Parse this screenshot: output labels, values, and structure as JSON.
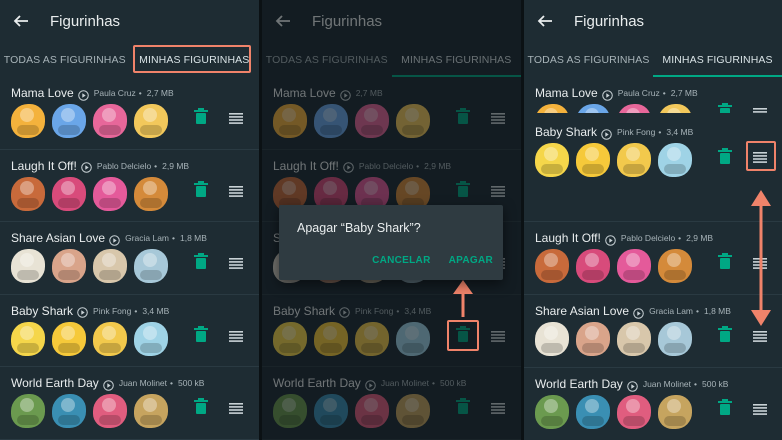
{
  "screens": [
    {
      "header": {
        "title": "Figurinhas"
      },
      "tabs": [
        {
          "label": "TODAS AS FIGURINHAS"
        },
        {
          "label": "MINHAS FIGURINHAS",
          "active": true
        }
      ],
      "packs": [
        {
          "name": "Mama Love",
          "author": "Paula Cruz",
          "size": "2,7 MB",
          "colors": [
            "#f4b23c",
            "#6aa6e8",
            "#e7679a",
            "#f2c85b"
          ]
        },
        {
          "name": "Laugh It Off!",
          "author": "Pablo Delcielo",
          "size": "2,9 MB",
          "colors": [
            "#c86a3b",
            "#d84b7b",
            "#e45a9a",
            "#d48a3a"
          ]
        },
        {
          "name": "Share Asian Love",
          "author": "Gracia Lam",
          "size": "1,8 MB",
          "colors": [
            "#e8e3d5",
            "#d9a48a",
            "#d8c7ab",
            "#a7c8d8"
          ]
        },
        {
          "name": "Baby Shark",
          "author": "Pink Fong",
          "size": "3,4 MB",
          "colors": [
            "#f5d64a",
            "#f6c93a",
            "#f2c94c",
            "#9fd3e6"
          ]
        },
        {
          "name": "World Earth Day",
          "author": "Juan Molinet",
          "size": "500 kB",
          "colors": [
            "#6b9a4f",
            "#3a8fb3",
            "#e05d7f",
            "#c6a45f"
          ]
        }
      ]
    },
    {
      "header": {
        "title": "Figurinhas"
      },
      "tabs": [
        {
          "label": "TODAS AS FIGURINHAS"
        },
        {
          "label": "MINHAS FIGURINHAS",
          "active": true
        }
      ],
      "packs": [
        {
          "name": "Mama Love",
          "author": "",
          "size": "2,7 MB",
          "colors": [
            "#f4b23c",
            "#6aa6e8",
            "#e7679a",
            "#f2c85b"
          ]
        },
        {
          "name": "Laugh It Off!",
          "author": "Pablo Delcielo",
          "size": "2,9 MB",
          "colors": [
            "#c86a3b",
            "#d84b7b",
            "#e45a9a",
            "#d48a3a"
          ]
        },
        {
          "name": "Share Asian Love",
          "author": "",
          "size": "",
          "colors": [
            "#e8e3d5",
            "#d9a48a",
            "#d8c7ab",
            "#a7c8d8"
          ]
        },
        {
          "name": "Baby Shark",
          "author": "Pink Fong",
          "size": "3,4 MB",
          "colors": [
            "#f5d64a",
            "#f6c93a",
            "#f2c94c",
            "#9fd3e6"
          ]
        },
        {
          "name": "World Earth Day",
          "author": "Juan Molinet",
          "size": "500 kB",
          "colors": [
            "#6b9a4f",
            "#3a8fb3",
            "#e05d7f",
            "#c6a45f"
          ]
        }
      ],
      "dialog": {
        "question": "Apagar “Baby Shark”?",
        "cancel": "CANCELAR",
        "confirm": "APAGAR"
      }
    },
    {
      "header": {
        "title": "Figurinhas"
      },
      "tabs": [
        {
          "label": "TODAS AS FIGURINHAS"
        },
        {
          "label": "MINHAS FIGURINHAS",
          "active": true
        }
      ],
      "packs": [
        {
          "name": "Mama Love",
          "author": "Paula Cruz",
          "size": "2,7 MB",
          "colors": [
            "#f4b23c",
            "#6aa6e8",
            "#e7679a",
            "#f2c85b"
          ]
        },
        {
          "name": "Baby Shark",
          "author": "Pink Fong",
          "size": "3,4 MB",
          "colors": [
            "#f5d64a",
            "#f6c93a",
            "#f2c94c",
            "#9fd3e6"
          ]
        },
        {
          "name": "Laugh It Off!",
          "author": "Pablo Delcielo",
          "size": "2,9 MB",
          "colors": [
            "#c86a3b",
            "#d84b7b",
            "#e45a9a",
            "#d48a3a"
          ]
        },
        {
          "name": "Share Asian Love",
          "author": "Gracia Lam",
          "size": "1,8 MB",
          "colors": [
            "#e8e3d5",
            "#d9a48a",
            "#d8c7ab",
            "#a7c8d8"
          ]
        },
        {
          "name": "World Earth Day",
          "author": "Juan Molinet",
          "size": "500 kB",
          "colors": [
            "#6b9a4f",
            "#3a8fb3",
            "#e05d7f",
            "#c6a45f"
          ]
        }
      ]
    }
  ],
  "colors": {
    "accent": "#00a884",
    "highlight": "#f0836a",
    "background": "#1e2c33",
    "icon": "#8696a0"
  }
}
